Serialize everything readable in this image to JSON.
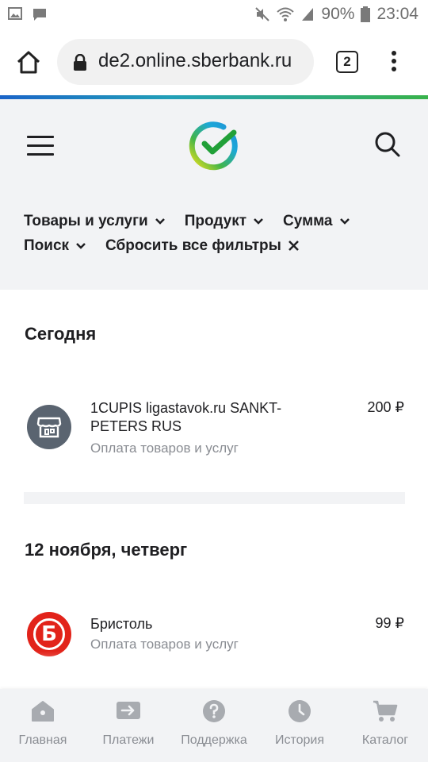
{
  "status_bar": {
    "battery": "90%",
    "time": "23:04"
  },
  "browser": {
    "url": "de2.online.sberbank.ru",
    "tab_count": "2"
  },
  "header": {
    "filters_row1": [
      {
        "label": "Товары и услуги"
      },
      {
        "label": "Продукт"
      },
      {
        "label": "Сумма"
      }
    ],
    "filters_row2": [
      {
        "label": "Поиск"
      }
    ],
    "reset_label": "Сбросить все фильтры"
  },
  "sections": [
    {
      "title": "Сегодня",
      "transactions": [
        {
          "merchant": "1CUPIS ligastavok.ru SANKT-PETERS RUS",
          "category": "Оплата товаров и услуг",
          "amount": "200 ₽",
          "icon": "store-icon",
          "icon_bg": "#5a6470"
        }
      ]
    },
    {
      "title": "12 ноября, четверг",
      "transactions": [
        {
          "merchant": "Бристоль",
          "category": "Оплата товаров и услуг",
          "amount": "99 ₽",
          "icon": "bristol-logo",
          "icon_letter": "Б",
          "icon_bg": "#e2231a"
        }
      ]
    }
  ],
  "bottom_nav": [
    {
      "label": "Главная",
      "icon": "home-icon"
    },
    {
      "label": "Платежи",
      "icon": "payments-icon"
    },
    {
      "label": "Поддержка",
      "icon": "support-icon"
    },
    {
      "label": "История",
      "icon": "history-icon"
    },
    {
      "label": "Каталог",
      "icon": "cart-icon"
    }
  ],
  "colors": {
    "brand_green": "#21a038",
    "muted": "#8a8d93",
    "nav_icon": "#a8abb0"
  }
}
